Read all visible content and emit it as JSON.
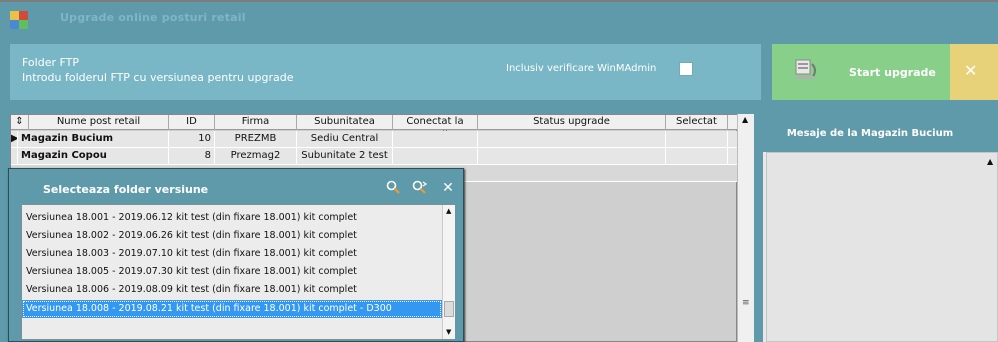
{
  "window": {
    "title": "Upgrade online posturi retail"
  },
  "colors": {
    "background": "#5f9aaa",
    "panel": "#79b7c6",
    "start": "#88cf8a",
    "close": "#e7d27a",
    "selected": "#3498f0"
  },
  "ftp": {
    "title": "Folder FTP",
    "subtitle": "Introdu folderul FTP cu versiunea pentru upgrade",
    "winmadmin_label": "Inclusiv verificare WinMAdmin"
  },
  "actions": {
    "start_label": "Start upgrade",
    "close_symbol": "✕"
  },
  "grid": {
    "sort_icon": "⇕",
    "columns": [
      "Nume post retail",
      "ID",
      "Firma",
      "Subunitatea",
      "Conectat la retail",
      "Status upgrade",
      "Selectat"
    ],
    "rows": [
      {
        "marker": "▶",
        "name": "Magazin Bucium",
        "id": "10",
        "firma": "PREZMB",
        "subunitate": "Sediu Central",
        "conectat": "",
        "status": "",
        "selectat": ""
      },
      {
        "marker": "",
        "name": "Magazin Copou",
        "id": "8",
        "firma": "Prezmag2",
        "subunitate": "Subunitate 2 test",
        "conectat": "",
        "status": "",
        "selectat": ""
      }
    ]
  },
  "messages": {
    "title": "Mesaje de la Magazin Bucium"
  },
  "popup": {
    "title": "Selecteaza folder versiune",
    "versions": [
      "Versiunea 18.001 - 2019.06.12 kit test (din fixare 18.001) kit complet",
      "Versiunea 18.002 - 2019.06.26 kit test (din fixare 18.001) kit complet",
      "Versiunea 18.003 - 2019.07.10 kit test (din fixare 18.001) kit complet",
      "Versiunea 18.005 - 2019.07.30 kit test (din fixare 18.001) kit complet",
      "Versiunea 18.006 - 2019.08.09 kit test (din fixare 18.001) kit complet",
      "Versiunea 18.008 - 2019.08.21 kit test (din fixare 18.001) kit complet - D300"
    ],
    "selected_index": 5
  }
}
